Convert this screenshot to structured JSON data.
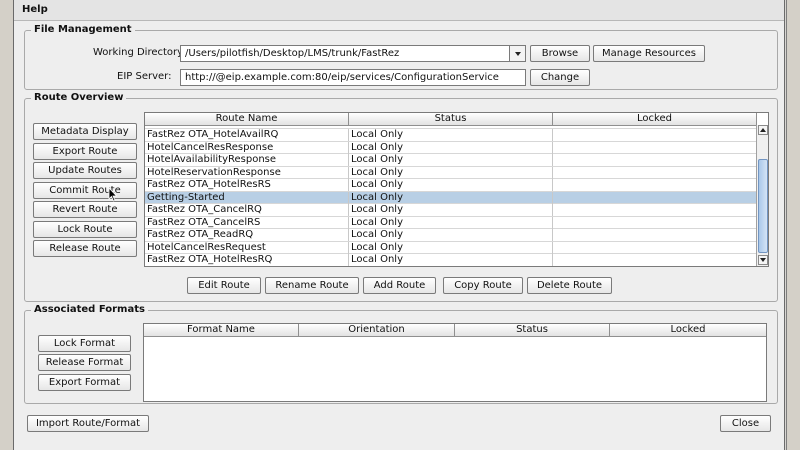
{
  "menubar": {
    "help": "Help"
  },
  "file_management": {
    "title": "File Management",
    "working_directory_label": "Working Directory:",
    "working_directory_value": "/Users/pilotfish/Desktop/LMS/trunk/FastRez",
    "browse": "Browse",
    "manage_resources": "Manage Resources",
    "eip_server_label": "EIP Server:",
    "eip_server_value": "http://@eip.example.com:80/eip/services/ConfigurationService",
    "change": "Change"
  },
  "route_overview": {
    "title": "Route Overview",
    "side_buttons": [
      "Metadata Display",
      "Export Route",
      "Update Routes",
      "Commit Route",
      "Revert Route",
      "Lock Route",
      "Release Route"
    ],
    "columns": [
      "Route Name",
      "Status",
      "Locked"
    ],
    "rows": [
      {
        "name": "FastRez OTA_HotelAvailRQ",
        "status": "Local Only",
        "locked": "",
        "selected": false
      },
      {
        "name": "HotelCancelResResponse",
        "status": "Local Only",
        "locked": "",
        "selected": false
      },
      {
        "name": "HotelAvailabilityResponse",
        "status": "Local Only",
        "locked": "",
        "selected": false
      },
      {
        "name": "HotelReservationResponse",
        "status": "Local Only",
        "locked": "",
        "selected": false
      },
      {
        "name": "FastRez OTA_HotelResRS",
        "status": "Local Only",
        "locked": "",
        "selected": false
      },
      {
        "name": "Getting-Started",
        "status": "Local Only",
        "locked": "",
        "selected": true
      },
      {
        "name": "FastRez OTA_CancelRQ",
        "status": "Local Only",
        "locked": "",
        "selected": false
      },
      {
        "name": "FastRez OTA_CancelRS",
        "status": "Local Only",
        "locked": "",
        "selected": false
      },
      {
        "name": "FastRez OTA_ReadRQ",
        "status": "Local Only",
        "locked": "",
        "selected": false
      },
      {
        "name": "HotelCancelResRequest",
        "status": "Local Only",
        "locked": "",
        "selected": false
      },
      {
        "name": "FastRez OTA_HotelResRQ",
        "status": "Local Only",
        "locked": "",
        "selected": false
      }
    ],
    "bottom_buttons": [
      "Edit Route",
      "Rename Route",
      "Add Route",
      "Copy Route",
      "Delete Route"
    ]
  },
  "associated_formats": {
    "title": "Associated Formats",
    "side_buttons": [
      "Lock Format",
      "Release Format",
      "Export Format"
    ],
    "columns": [
      "Format Name",
      "Orientation",
      "Status",
      "Locked"
    ]
  },
  "footer": {
    "import": "Import Route/Format",
    "close": "Close"
  },
  "colors": {
    "selection": "#b8cfe5",
    "scroll_thumb": "#aac8ea",
    "dialog_bg": "#eeeeee"
  }
}
